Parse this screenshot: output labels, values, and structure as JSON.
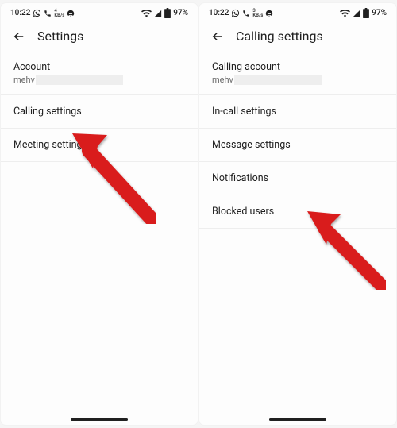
{
  "status": {
    "time": "10:22",
    "kb_rate_left": "4",
    "kb_rate_right": "3",
    "kb_unit": "KB/s",
    "battery": "97%"
  },
  "left": {
    "title": "Settings",
    "account_label": "Account",
    "account_value": "mehv",
    "items": [
      "Calling settings",
      "Meeting settings"
    ]
  },
  "right": {
    "title": "Calling settings",
    "account_label": "Calling account",
    "account_value": "mehv",
    "items": [
      "In-call settings",
      "Message settings",
      "Notifications",
      "Blocked users"
    ]
  }
}
